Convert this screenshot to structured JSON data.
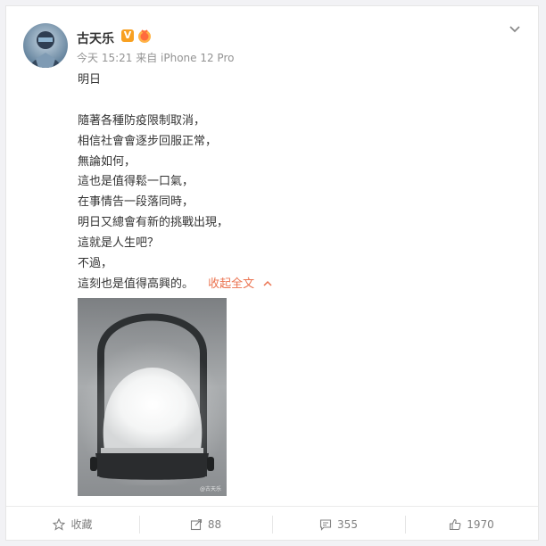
{
  "post": {
    "author": "古天乐",
    "vip_mark": "V",
    "meta": "今天 15:21 来自 iPhone 12 Pro",
    "body": {
      "title_line": "明日",
      "lines": [
        "隨著各種防疫限制取消，",
        "相信社會會逐步回服正常，",
        "無論如何，",
        "這也是值得鬆一口氣，",
        "在事情告一段落同時，",
        "明日又總會有新的挑戰出現，",
        "這就是人生吧？",
        "不過，",
        "這刻也是值得高興的。"
      ],
      "collapse_label": "收起全文"
    },
    "image": {
      "watermark": "@古天乐"
    }
  },
  "actions": {
    "favorite_label": "收藏",
    "share_count": "88",
    "comment_count": "355",
    "like_count": "1970"
  },
  "colors": {
    "accent": "#eb7350",
    "muted": "#939393",
    "vip": "#f8a020"
  },
  "icons": [
    "avatar",
    "vip-icon",
    "badge-icon",
    "chevron-down-icon",
    "star-icon",
    "share-icon",
    "comment-icon",
    "thumbs-up-icon"
  ]
}
